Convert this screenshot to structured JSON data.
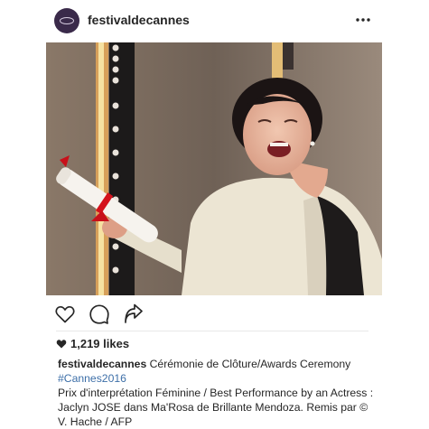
{
  "post": {
    "username": "festivaldecannes",
    "likes": "1,219 likes",
    "caption_title": "Cérémonie de Clôture/Awards Ceremony",
    "hashtag": "#Cannes2016",
    "caption_body": "Prix d'interprétation Féminine / Best Performance by an Actress : Jaclyn JOSE dans Ma'Rosa de Brillante Mendoza. Remis par © V. Hache / AFP"
  },
  "icons": {
    "avatar": "festival-logo-icon",
    "more": "more-dots-icon",
    "like": "heart-icon",
    "comment": "comment-bubble-icon",
    "share": "share-arrow-icon",
    "likes_heart": "filled-heart-icon"
  },
  "colors": {
    "text": "#262626",
    "hashtag": "#3d6fa8",
    "avatar_bg": "#3a2a4a"
  }
}
